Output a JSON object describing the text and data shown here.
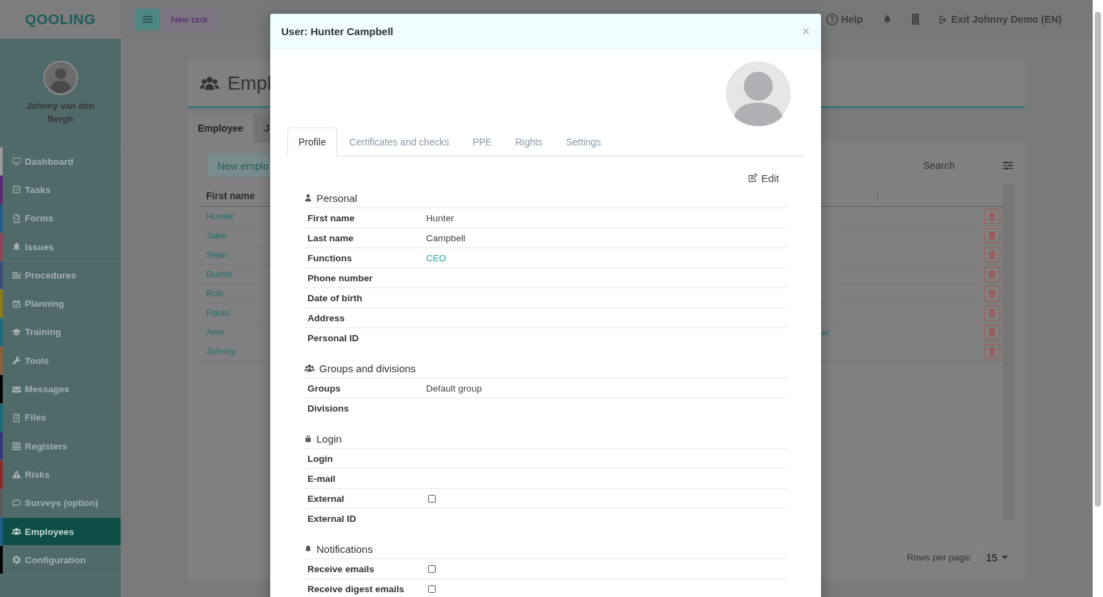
{
  "topbar": {
    "logo": "QOOLING",
    "new_task": "New task",
    "help": "Help",
    "exit": "Exit Johnny Demo (EN)"
  },
  "sidebar": {
    "user": "Johnny van den Bergh",
    "items": [
      {
        "label": "Dashboard",
        "color": "#9a9a9a",
        "selected": false
      },
      {
        "label": "Tasks",
        "color": "#5a2a74",
        "selected": false
      },
      {
        "label": "Forms",
        "color": "#1f5f86",
        "selected": false
      },
      {
        "label": "Issues",
        "color": "#8a4656",
        "selected": false
      },
      {
        "label": "Procedures",
        "color": "#3f4d7a",
        "selected": false
      },
      {
        "label": "Planning",
        "color": "#8a7c1a",
        "selected": false
      },
      {
        "label": "Training",
        "color": "#1a6a78",
        "selected": false
      },
      {
        "label": "Tools",
        "color": "#8a6040",
        "selected": false
      },
      {
        "label": "Messages",
        "color": "#000000",
        "selected": false
      },
      {
        "label": "Files",
        "color": "#1a6a78",
        "selected": false
      },
      {
        "label": "Registers",
        "color": "#34367a",
        "selected": false
      },
      {
        "label": "Risks",
        "color": "#8a2a2a",
        "selected": false
      },
      {
        "label": "Surveys (option)",
        "color": "#5a5a5a",
        "selected": false
      },
      {
        "label": "Employees",
        "color": "#1f5f86",
        "selected": true
      },
      {
        "label": "Configuration",
        "color": "#000000",
        "selected": false
      }
    ]
  },
  "page": {
    "title": "Empl",
    "tabs": [
      {
        "label": "Employee",
        "selected": true
      },
      {
        "label": "J",
        "selected": false
      }
    ],
    "new_button": "New emplo",
    "search": {
      "placeholder": "Search"
    },
    "table": {
      "columns": [
        "First name"
      ],
      "rows": [
        {
          "first_name": "Hunter"
        },
        {
          "first_name": "Jake"
        },
        {
          "first_name": "Sean"
        },
        {
          "first_name": "Dustin"
        },
        {
          "first_name": "Rob"
        },
        {
          "first_name": "Paulo"
        },
        {
          "first_name": "Alex",
          "column_3": "er"
        },
        {
          "first_name": "Johnny"
        }
      ]
    },
    "rows_per_page": {
      "label": "Rows per page:",
      "value": "15"
    }
  },
  "modal": {
    "title": "User: Hunter Campbell",
    "close": "×",
    "tabs": [
      {
        "label": "Profile",
        "selected": true
      },
      {
        "label": "Certificates and checks",
        "selected": false
      },
      {
        "label": "PPE",
        "selected": false
      },
      {
        "label": "Rights",
        "selected": false
      },
      {
        "label": "Settings",
        "selected": false
      }
    ],
    "edit": "Edit",
    "sections": [
      {
        "title": "Personal",
        "fields": [
          {
            "label": "First name",
            "kind": "text",
            "value": "Hunter"
          },
          {
            "label": "Last name",
            "kind": "text",
            "value": "Campbell"
          },
          {
            "label": "Functions",
            "kind": "link",
            "value": "CEO"
          },
          {
            "label": "Phone number",
            "kind": "text"
          },
          {
            "label": "Date of birth",
            "kind": "text"
          },
          {
            "label": "Address",
            "kind": "text"
          },
          {
            "label": "Personal ID",
            "kind": "text"
          }
        ]
      },
      {
        "title": "Groups and divisions",
        "fields": [
          {
            "label": "Groups",
            "kind": "text",
            "value": "Default group"
          },
          {
            "label": "Divisions",
            "kind": "text"
          }
        ]
      },
      {
        "title": "Login",
        "fields": [
          {
            "label": "Login",
            "kind": "text"
          },
          {
            "label": "E-mail",
            "kind": "text"
          },
          {
            "label": "External",
            "kind": "checkbox",
            "checked": false
          },
          {
            "label": "External ID",
            "kind": "text"
          }
        ]
      },
      {
        "title": "Notifications",
        "fields": [
          {
            "label": "Receive emails",
            "kind": "checkbox",
            "checked": false
          },
          {
            "label": "Receive digest emails",
            "kind": "checkbox",
            "checked": false
          }
        ]
      }
    ]
  }
}
